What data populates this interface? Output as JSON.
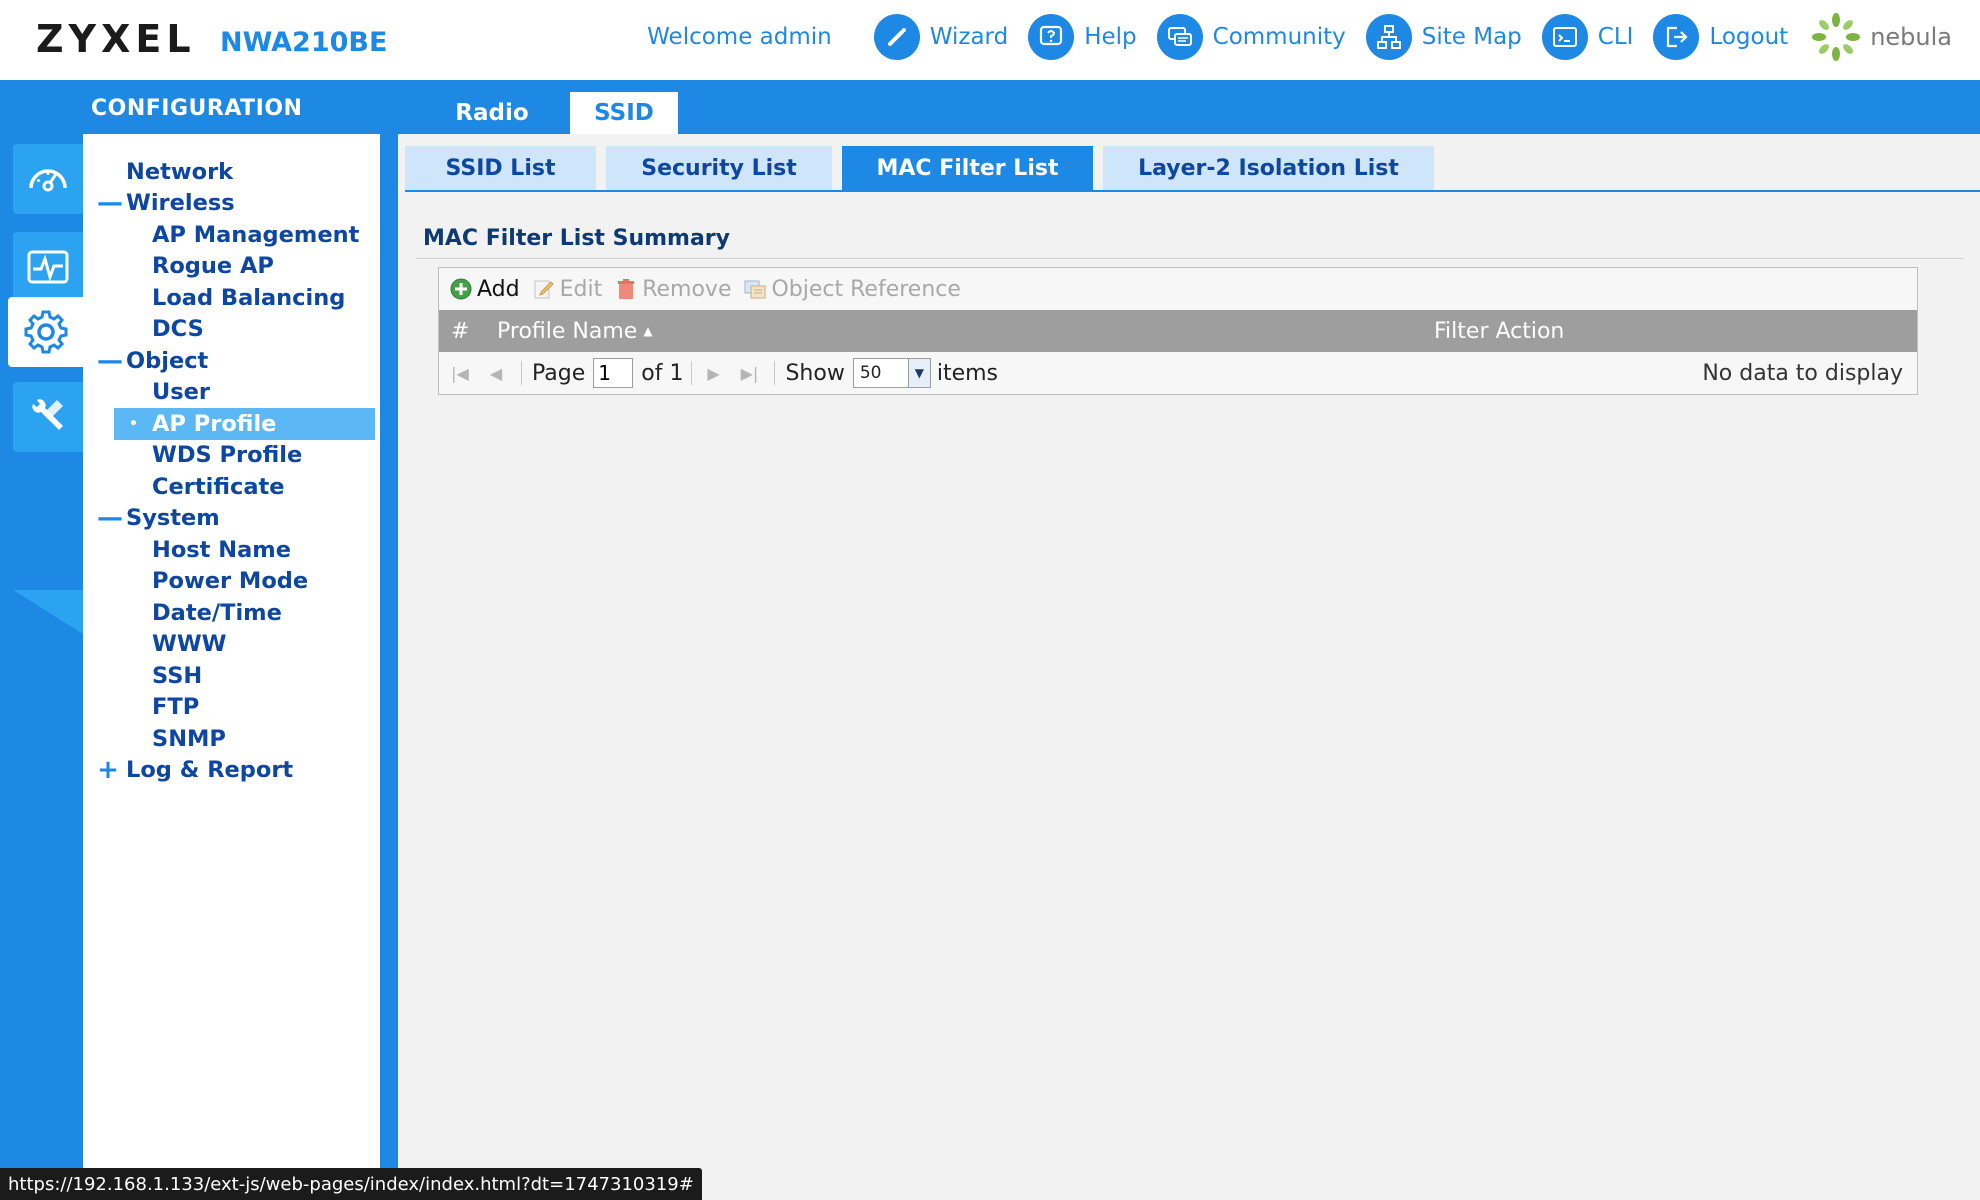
{
  "header": {
    "brand": "ZYXEL",
    "model": "NWA210BE",
    "welcome": "Welcome admin",
    "nav": [
      {
        "label": "Wizard",
        "icon": "wand-icon"
      },
      {
        "label": "Help",
        "icon": "help-icon"
      },
      {
        "label": "Community",
        "icon": "chat-icon"
      },
      {
        "label": "Site Map",
        "icon": "sitemap-icon"
      },
      {
        "label": "CLI",
        "icon": "terminal-icon"
      },
      {
        "label": "Logout",
        "icon": "logout-icon"
      }
    ],
    "nebula": "nebula"
  },
  "section_title": "CONFIGURATION",
  "main_tabs": [
    {
      "label": "Radio",
      "active": false
    },
    {
      "label": "SSID",
      "active": true
    }
  ],
  "rail": [
    {
      "icon": "dashboard-icon",
      "active": false
    },
    {
      "icon": "monitor-icon",
      "active": false
    },
    {
      "icon": "gear-icon",
      "active": true
    },
    {
      "icon": "maintenance-icon",
      "active": false
    }
  ],
  "tree": {
    "network": "Network",
    "wireless": "Wireless",
    "ap_management": "AP Management",
    "rogue_ap": "Rogue AP",
    "load_balancing": "Load Balancing",
    "dcs": "DCS",
    "object": "Object",
    "user": "User",
    "ap_profile": "AP Profile",
    "wds_profile": "WDS Profile",
    "certificate": "Certificate",
    "system": "System",
    "host_name": "Host Name",
    "power_mode": "Power Mode",
    "date_time": "Date/Time",
    "www": "WWW",
    "ssh": "SSH",
    "ftp": "FTP",
    "snmp": "SNMP",
    "log_report": "Log & Report",
    "collapse_sign": "—",
    "expand_sign": "+"
  },
  "sub_tabs": [
    {
      "label": "SSID List",
      "active": false
    },
    {
      "label": "Security List",
      "active": false
    },
    {
      "label": "MAC Filter List",
      "active": true
    },
    {
      "label": "Layer-2 Isolation List",
      "active": false
    }
  ],
  "summary": {
    "title": "MAC Filter List Summary",
    "toolbar": {
      "add": "Add",
      "edit": "Edit",
      "remove": "Remove",
      "object_reference": "Object Reference"
    },
    "columns": {
      "num": "#",
      "profile_name": "Profile Name",
      "filter_action": "Filter Action"
    },
    "pager": {
      "page_label": "Page",
      "page_value": "1",
      "of_label": "of 1",
      "show_label": "Show",
      "show_value": "50",
      "items_label": "items",
      "no_data": "No data to display"
    }
  },
  "status_url": "https://192.168.1.133/ext-js/web-pages/index/index.html?dt=1747310319#",
  "colors": {
    "primary_blue": "#1e88e5",
    "navy_text": "#0d47a1",
    "selected_bg": "#5bb8f5",
    "header_grey": "#9e9e9e"
  }
}
